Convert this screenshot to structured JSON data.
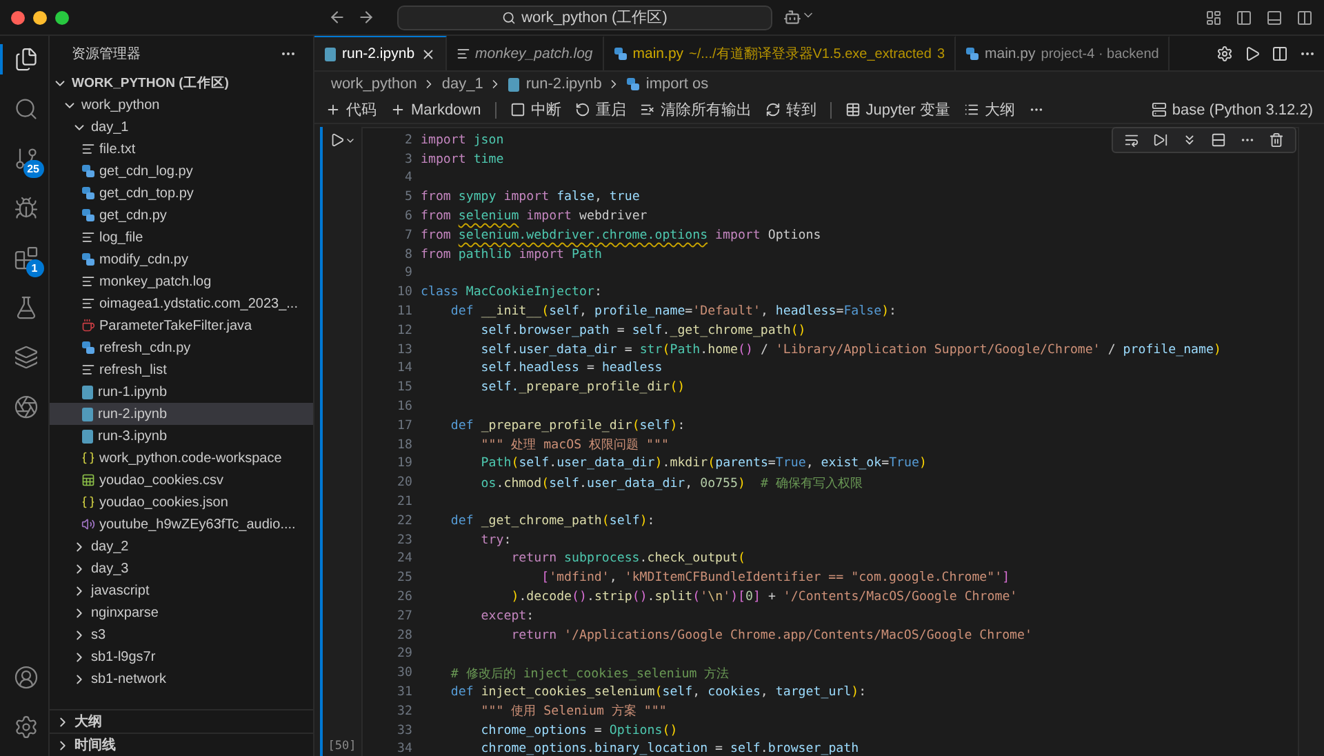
{
  "window": {
    "command_center": "work_python (工作区)"
  },
  "activity_bar": {
    "top": [
      {
        "kind": "explorer",
        "selected": true
      },
      {
        "kind": "search",
        "selected": false
      },
      {
        "kind": "source-control",
        "selected": false,
        "badge": "25"
      },
      {
        "kind": "debug",
        "selected": false
      },
      {
        "kind": "extensions",
        "selected": false,
        "badge": "1"
      },
      {
        "kind": "testing",
        "selected": false
      },
      {
        "kind": "layers",
        "selected": false
      },
      {
        "kind": "aperture",
        "selected": false
      }
    ],
    "bottom": [
      {
        "kind": "account",
        "selected": false
      },
      {
        "kind": "settings",
        "selected": false
      }
    ]
  },
  "sidebar": {
    "title": "资源管理器",
    "workspace": {
      "label": "WORK_PYTHON (工作区)",
      "expanded": true
    },
    "tree": [
      {
        "label": "work_python",
        "kind": "folder",
        "expanded": true,
        "selected": false,
        "children": [
          {
            "label": "day_1",
            "kind": "folder",
            "expanded": true,
            "selected": false,
            "children": [
              {
                "label": "file.txt",
                "kind": "text",
                "selected": false
              },
              {
                "label": "get_cdn_log.py",
                "kind": "python",
                "selected": false
              },
              {
                "label": "get_cdn_top.py",
                "kind": "python",
                "selected": false
              },
              {
                "label": "get_cdn.py",
                "kind": "python",
                "selected": false
              },
              {
                "label": "log_file",
                "kind": "text",
                "selected": false
              },
              {
                "label": "modify_cdn.py",
                "kind": "python",
                "selected": false
              },
              {
                "label": "monkey_patch.log",
                "kind": "text",
                "selected": false
              },
              {
                "label": "oimagea1.ydstatic.com_2023_...",
                "kind": "text",
                "selected": false
              },
              {
                "label": "ParameterTakeFilter.java",
                "kind": "java",
                "selected": false
              },
              {
                "label": "refresh_cdn.py",
                "kind": "python",
                "selected": false
              },
              {
                "label": "refresh_list",
                "kind": "text",
                "selected": false
              },
              {
                "label": "run-1.ipynb",
                "kind": "notebook",
                "selected": false
              },
              {
                "label": "run-2.ipynb",
                "kind": "notebook",
                "selected": true
              },
              {
                "label": "run-3.ipynb",
                "kind": "notebook",
                "selected": false
              },
              {
                "label": "work_python.code-workspace",
                "kind": "json",
                "selected": false
              },
              {
                "label": "youdao_cookies.csv",
                "kind": "csv",
                "selected": false
              },
              {
                "label": "youdao_cookies.json",
                "kind": "json",
                "selected": false
              },
              {
                "label": "youtube_h9wZEy63fTc_audio....",
                "kind": "audio",
                "selected": false
              }
            ]
          },
          {
            "label": "day_2",
            "kind": "folder",
            "expanded": false,
            "selected": false
          },
          {
            "label": "day_3",
            "kind": "folder",
            "expanded": false,
            "selected": false
          },
          {
            "label": "javascript",
            "kind": "folder",
            "expanded": false,
            "selected": false
          },
          {
            "label": "nginxparse",
            "kind": "folder",
            "expanded": false,
            "selected": false
          },
          {
            "label": "s3",
            "kind": "folder",
            "expanded": false,
            "selected": false
          },
          {
            "label": "sb1-l9gs7r",
            "kind": "folder",
            "expanded": false,
            "selected": false
          },
          {
            "label": "sb1-network",
            "kind": "folder",
            "expanded": false,
            "selected": false
          }
        ]
      }
    ],
    "panels": [
      {
        "label": "大纲",
        "expanded": false
      },
      {
        "label": "时间线",
        "expanded": false
      }
    ]
  },
  "tabs": [
    {
      "label": "run-2.ipynb",
      "kind": "notebook",
      "selected": true,
      "preview": false,
      "warning": false
    },
    {
      "label": "monkey_patch.log",
      "kind": "text",
      "selected": false,
      "preview": true,
      "warning": false
    },
    {
      "label": "main.py",
      "kind": "python",
      "selected": false,
      "preview": false,
      "warning": true,
      "description": "~/.../有道翻译登录器V1.5.exe_extracted",
      "problems": "3"
    },
    {
      "label": "main.py",
      "kind": "python",
      "selected": false,
      "preview": false,
      "warning": false,
      "description": "project-4 · backend"
    }
  ],
  "breadcrumb": [
    {
      "label": "work_python",
      "kind": "folder"
    },
    {
      "label": "day_1",
      "kind": "folder"
    },
    {
      "label": "run-2.ipynb",
      "kind": "notebook"
    },
    {
      "label": "import os",
      "kind": "python"
    }
  ],
  "notebook_toolbar": [
    {
      "kind": "add",
      "label": "代码"
    },
    {
      "kind": "add",
      "label": "Markdown"
    },
    {
      "kind": "separator"
    },
    {
      "kind": "interrupt",
      "label": "中断"
    },
    {
      "kind": "restart",
      "label": "重启"
    },
    {
      "kind": "clear",
      "label": "清除所有输出"
    },
    {
      "kind": "goto",
      "label": "转到"
    },
    {
      "kind": "separator"
    },
    {
      "kind": "variables",
      "label": "Jupyter 变量"
    },
    {
      "kind": "outline",
      "label": "大纲"
    },
    {
      "kind": "more"
    }
  ],
  "kernel": "base (Python 3.12.2)",
  "cell": {
    "execution_count": "[50]",
    "lines": [
      {
        "number": "2",
        "tokens": [
          {
            "kind": "k",
            "text": "import "
          },
          {
            "kind": "c",
            "text": "json"
          }
        ]
      },
      {
        "number": "3",
        "tokens": [
          {
            "kind": "k",
            "text": "import "
          },
          {
            "kind": "c",
            "text": "time"
          }
        ]
      },
      {
        "number": "4"
      },
      {
        "number": "5",
        "tokens": [
          {
            "kind": "k",
            "text": "from "
          },
          {
            "kind": "c",
            "text": "sympy "
          },
          {
            "kind": "k",
            "text": "import "
          },
          {
            "kind": "v",
            "text": "false"
          },
          {
            "kind": "p",
            "text": ", "
          },
          {
            "kind": "v",
            "text": "true"
          }
        ]
      },
      {
        "number": "6",
        "tokens": [
          {
            "kind": "k",
            "text": "from "
          },
          {
            "kind": "w",
            "text": "selenium"
          },
          {
            "kind": "k",
            "text": " import"
          },
          {
            "kind": "p",
            "text": " webdriver"
          }
        ]
      },
      {
        "number": "7",
        "tokens": [
          {
            "kind": "k",
            "text": "from "
          },
          {
            "kind": "w",
            "text": "selenium.webdriver.chrome.options"
          },
          {
            "kind": "k",
            "text": " import"
          },
          {
            "kind": "p",
            "text": " Options"
          }
        ]
      },
      {
        "number": "8",
        "tokens": [
          {
            "kind": "k",
            "text": "from "
          },
          {
            "kind": "c",
            "text": "pathlib "
          },
          {
            "kind": "k",
            "text": "import "
          },
          {
            "kind": "c",
            "text": "Path"
          }
        ]
      },
      {
        "number": "9"
      },
      {
        "number": "10",
        "tokens": [
          {
            "kind": "d",
            "text": "class "
          },
          {
            "kind": "c",
            "text": "MacCookieInjector"
          },
          {
            "kind": "p",
            "text": ":"
          }
        ]
      },
      {
        "number": "11",
        "tokens": [
          {
            "kind": "d",
            "text": "    def "
          },
          {
            "kind": "f",
            "text": "__init__"
          },
          {
            "kind": "y",
            "text": "("
          },
          {
            "kind": "v",
            "text": "self"
          },
          {
            "kind": "p",
            "text": ", "
          },
          {
            "kind": "v",
            "text": "profile_name"
          },
          {
            "kind": "p",
            "text": "="
          },
          {
            "kind": "s",
            "text": "'Default'"
          },
          {
            "kind": "p",
            "text": ", "
          },
          {
            "kind": "v",
            "text": "headless"
          },
          {
            "kind": "p",
            "text": "="
          },
          {
            "kind": "d",
            "text": "False"
          },
          {
            "kind": "y",
            "text": ")"
          },
          {
            "kind": "p",
            "text": ":"
          }
        ]
      },
      {
        "number": "12",
        "tokens": [
          {
            "kind": "v",
            "text": "        self"
          },
          {
            "kind": "p",
            "text": "."
          },
          {
            "kind": "v",
            "text": "browser_path"
          },
          {
            "kind": "p",
            "text": " = "
          },
          {
            "kind": "v",
            "text": "self"
          },
          {
            "kind": "p",
            "text": "."
          },
          {
            "kind": "f",
            "text": "_get_chrome_path"
          },
          {
            "kind": "y",
            "text": "()"
          }
        ]
      },
      {
        "number": "13",
        "tokens": [
          {
            "kind": "v",
            "text": "        self"
          },
          {
            "kind": "p",
            "text": "."
          },
          {
            "kind": "v",
            "text": "user_data_dir"
          },
          {
            "kind": "p",
            "text": " = "
          },
          {
            "kind": "c",
            "text": "str"
          },
          {
            "kind": "y",
            "text": "("
          },
          {
            "kind": "c",
            "text": "Path"
          },
          {
            "kind": "p",
            "text": "."
          },
          {
            "kind": "f",
            "text": "home"
          },
          {
            "kind": "z",
            "text": "()"
          },
          {
            "kind": "p",
            "text": " / "
          },
          {
            "kind": "s",
            "text": "'Library/Application Support/Google/Chrome'"
          },
          {
            "kind": "p",
            "text": " / "
          },
          {
            "kind": "v",
            "text": "profile_name"
          },
          {
            "kind": "y",
            "text": ")"
          }
        ]
      },
      {
        "number": "14",
        "tokens": [
          {
            "kind": "v",
            "text": "        self"
          },
          {
            "kind": "p",
            "text": "."
          },
          {
            "kind": "v",
            "text": "headless"
          },
          {
            "kind": "p",
            "text": " = "
          },
          {
            "kind": "v",
            "text": "headless"
          }
        ]
      },
      {
        "number": "15",
        "tokens": [
          {
            "kind": "v",
            "text": "        self."
          },
          {
            "kind": "f",
            "text": "_prepare_profile_dir"
          },
          {
            "kind": "y",
            "text": "()"
          }
        ]
      },
      {
        "number": "16"
      },
      {
        "number": "17",
        "tokens": [
          {
            "kind": "d",
            "text": "    def "
          },
          {
            "kind": "f",
            "text": "_prepare_profile_dir"
          },
          {
            "kind": "y",
            "text": "("
          },
          {
            "kind": "v",
            "text": "self"
          },
          {
            "kind": "y",
            "text": ")"
          },
          {
            "kind": "p",
            "text": ":"
          }
        ]
      },
      {
        "number": "18",
        "tokens": [
          {
            "kind": "s",
            "text": "        \"\"\" 处理 macOS 权限问题 \"\"\""
          }
        ]
      },
      {
        "number": "19",
        "tokens": [
          {
            "kind": "c",
            "text": "        Path"
          },
          {
            "kind": "y",
            "text": "("
          },
          {
            "kind": "v",
            "text": "self"
          },
          {
            "kind": "p",
            "text": "."
          },
          {
            "kind": "v",
            "text": "user_data_dir"
          },
          {
            "kind": "y",
            "text": ")"
          },
          {
            "kind": "p",
            "text": "."
          },
          {
            "kind": "f",
            "text": "mkdir"
          },
          {
            "kind": "y",
            "text": "("
          },
          {
            "kind": "v",
            "text": "parents"
          },
          {
            "kind": "p",
            "text": "="
          },
          {
            "kind": "d",
            "text": "True"
          },
          {
            "kind": "p",
            "text": ", "
          },
          {
            "kind": "v",
            "text": "exist_ok"
          },
          {
            "kind": "p",
            "text": "="
          },
          {
            "kind": "d",
            "text": "True"
          },
          {
            "kind": "y",
            "text": ")"
          }
        ]
      },
      {
        "number": "20",
        "tokens": [
          {
            "kind": "c",
            "text": "        os"
          },
          {
            "kind": "p",
            "text": "."
          },
          {
            "kind": "f",
            "text": "chmod"
          },
          {
            "kind": "y",
            "text": "("
          },
          {
            "kind": "v",
            "text": "self"
          },
          {
            "kind": "p",
            "text": "."
          },
          {
            "kind": "v",
            "text": "user_data_dir"
          },
          {
            "kind": "p",
            "text": ", "
          },
          {
            "kind": "n",
            "text": "0o755"
          },
          {
            "kind": "y",
            "text": ")  "
          },
          {
            "kind": "m",
            "text": "# 确保有写入权限"
          }
        ]
      },
      {
        "number": "21"
      },
      {
        "number": "22",
        "tokens": [
          {
            "kind": "d",
            "text": "    def "
          },
          {
            "kind": "f",
            "text": "_get_chrome_path"
          },
          {
            "kind": "y",
            "text": "("
          },
          {
            "kind": "v",
            "text": "self"
          },
          {
            "kind": "y",
            "text": ")"
          },
          {
            "kind": "p",
            "text": ":"
          }
        ]
      },
      {
        "number": "23",
        "tokens": [
          {
            "kind": "k",
            "text": "        try"
          },
          {
            "kind": "p",
            "text": ":"
          }
        ]
      },
      {
        "number": "24",
        "tokens": [
          {
            "kind": "k",
            "text": "            return "
          },
          {
            "kind": "c",
            "text": "subprocess"
          },
          {
            "kind": "p",
            "text": "."
          },
          {
            "kind": "f",
            "text": "check_output"
          },
          {
            "kind": "y",
            "text": "("
          }
        ]
      },
      {
        "number": "25",
        "tokens": [
          {
            "kind": "z",
            "text": "                ["
          },
          {
            "kind": "s",
            "text": "'mdfind'"
          },
          {
            "kind": "p",
            "text": ", "
          },
          {
            "kind": "s",
            "text": "'kMDItemCFBundleIdentifier == \"com.google.Chrome\"'"
          },
          {
            "kind": "z",
            "text": "]"
          }
        ]
      },
      {
        "number": "26",
        "tokens": [
          {
            "kind": "y",
            "text": "            )"
          },
          {
            "kind": "p",
            "text": "."
          },
          {
            "kind": "f",
            "text": "decode"
          },
          {
            "kind": "z",
            "text": "()"
          },
          {
            "kind": "p",
            "text": "."
          },
          {
            "kind": "f",
            "text": "strip"
          },
          {
            "kind": "z",
            "text": "()"
          },
          {
            "kind": "p",
            "text": "."
          },
          {
            "kind": "f",
            "text": "split"
          },
          {
            "kind": "z",
            "text": "("
          },
          {
            "kind": "s",
            "text": "'"
          },
          {
            "kind": "e",
            "text": "\\n"
          },
          {
            "kind": "s",
            "text": "'"
          },
          {
            "kind": "z",
            "text": ")["
          },
          {
            "kind": "n",
            "text": "0"
          },
          {
            "kind": "z",
            "text": "]"
          },
          {
            "kind": "p",
            "text": " + "
          },
          {
            "kind": "s",
            "text": "'/Contents/MacOS/Google Chrome'"
          }
        ]
      },
      {
        "number": "27",
        "tokens": [
          {
            "kind": "k",
            "text": "        except"
          },
          {
            "kind": "p",
            "text": ":"
          }
        ]
      },
      {
        "number": "28",
        "tokens": [
          {
            "kind": "k",
            "text": "            return "
          },
          {
            "kind": "s",
            "text": "'/Applications/Google Chrome.app/Contents/MacOS/Google Chrome'"
          }
        ]
      },
      {
        "number": "29"
      },
      {
        "number": "30",
        "tokens": [
          {
            "kind": "m",
            "text": "    # 修改后的 inject_cookies_selenium 方法"
          }
        ]
      },
      {
        "number": "31",
        "tokens": [
          {
            "kind": "d",
            "text": "    def "
          },
          {
            "kind": "f",
            "text": "inject_cookies_selenium"
          },
          {
            "kind": "y",
            "text": "("
          },
          {
            "kind": "v",
            "text": "self"
          },
          {
            "kind": "p",
            "text": ", "
          },
          {
            "kind": "v",
            "text": "cookies"
          },
          {
            "kind": "p",
            "text": ", "
          },
          {
            "kind": "v",
            "text": "target_url"
          },
          {
            "kind": "y",
            "text": ")"
          },
          {
            "kind": "p",
            "text": ":"
          }
        ]
      },
      {
        "number": "32",
        "tokens": [
          {
            "kind": "s",
            "text": "        \"\"\" 使用 Selenium 方案 \"\"\""
          }
        ]
      },
      {
        "number": "33",
        "tokens": [
          {
            "kind": "v",
            "text": "        chrome_options"
          },
          {
            "kind": "p",
            "text": " = "
          },
          {
            "kind": "c",
            "text": "Options"
          },
          {
            "kind": "y",
            "text": "()"
          }
        ]
      },
      {
        "number": "34",
        "tokens": [
          {
            "kind": "v",
            "text": "        chrome_options"
          },
          {
            "kind": "p",
            "text": "."
          },
          {
            "kind": "v",
            "text": "binary_location"
          },
          {
            "kind": "p",
            "text": " = "
          },
          {
            "kind": "v",
            "text": "self"
          },
          {
            "kind": "p",
            "text": "."
          },
          {
            "kind": "v",
            "text": "browser_path"
          }
        ]
      }
    ]
  }
}
